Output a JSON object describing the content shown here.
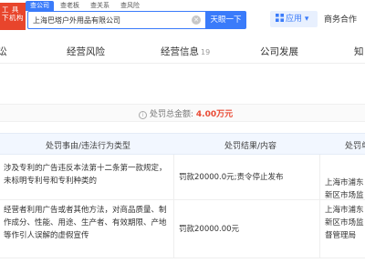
{
  "brand": {
    "line1": "工 具",
    "line2": "下机构"
  },
  "search": {
    "tabs": [
      "查公司",
      "查老板",
      "查关系",
      "查风险"
    ],
    "value": "上海巴塔户外用品有限公司",
    "button_label": "天眼一下"
  },
  "header": {
    "apps_label": "应用",
    "biz_label": "商务合作"
  },
  "nav": {
    "items": [
      {
        "label": "讼",
        "count": ""
      },
      {
        "label": "经营风险",
        "count": ""
      },
      {
        "label": "经营信息",
        "count": "19"
      },
      {
        "label": "公司发展",
        "count": ""
      },
      {
        "label": "知",
        "count": ""
      }
    ]
  },
  "total": {
    "label": "处罚总金额:",
    "amount": "4.00",
    "unit": "万元"
  },
  "table": {
    "headers": [
      "处罚事由/违法行为类型",
      "处罚结果/内容",
      "处罚单"
    ],
    "rows": [
      {
        "reason": "涉及专利的广告违反本法第十二条第一款规定，未标明专利号和专利种类的",
        "result": "罚款20000.0元;责令停止发布",
        "org": "上海市浦东新区市场监督管理局"
      },
      {
        "reason": "经营者利用广告或者其他方法，对商品质量、制作成分、性能、用途、生产者、有效期限、产地等作引人误解的虚假宣传",
        "result": "罚款20000.00元",
        "org": "上海市浦东新区市场监督管理局"
      }
    ]
  },
  "colors": {
    "accent": "#3a7bfa",
    "brand": "#e8452c",
    "penalty": "#e94b35"
  }
}
